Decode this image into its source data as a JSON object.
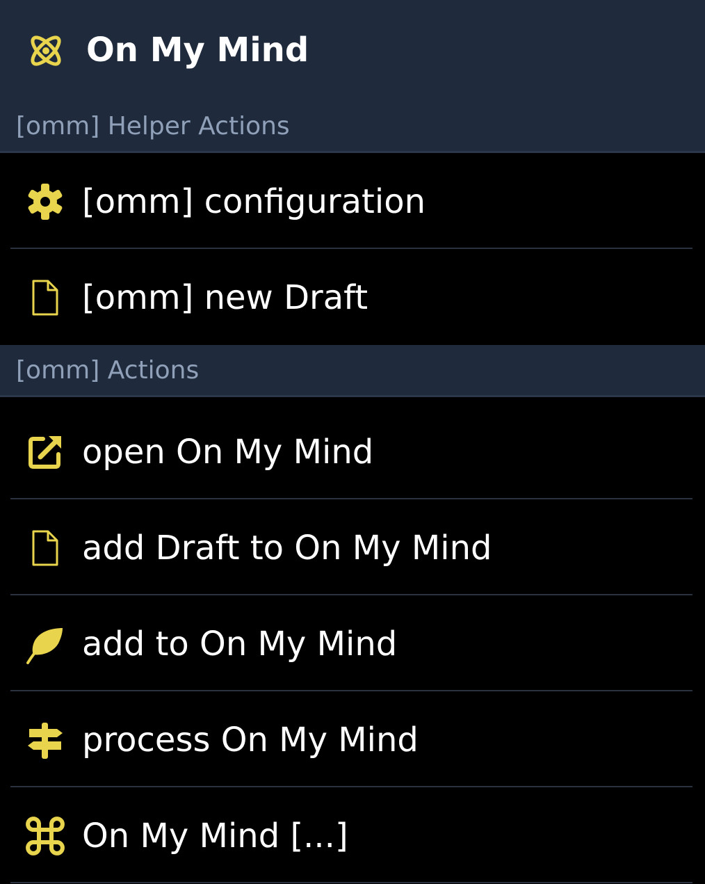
{
  "app": {
    "title": "On My Mind",
    "accent_color": "#e8d44d",
    "header_bg": "#1f2a3c",
    "logo_icon": "atom-icon"
  },
  "sections": [
    {
      "title": "[omm] Helper Actions",
      "items": [
        {
          "label": "[omm] configuration",
          "icon": "gear-icon"
        },
        {
          "label": "[omm] new Draft",
          "icon": "document-icon"
        }
      ]
    },
    {
      "title": "[omm] Actions",
      "items": [
        {
          "label": "open On My Mind",
          "icon": "external-link-icon"
        },
        {
          "label": "add Draft to On My Mind",
          "icon": "document-icon"
        },
        {
          "label": "add to On My Mind",
          "icon": "feather-icon"
        },
        {
          "label": "process On My Mind",
          "icon": "signpost-icon"
        },
        {
          "label": "On My Mind [...]",
          "icon": "command-icon"
        }
      ]
    }
  ]
}
